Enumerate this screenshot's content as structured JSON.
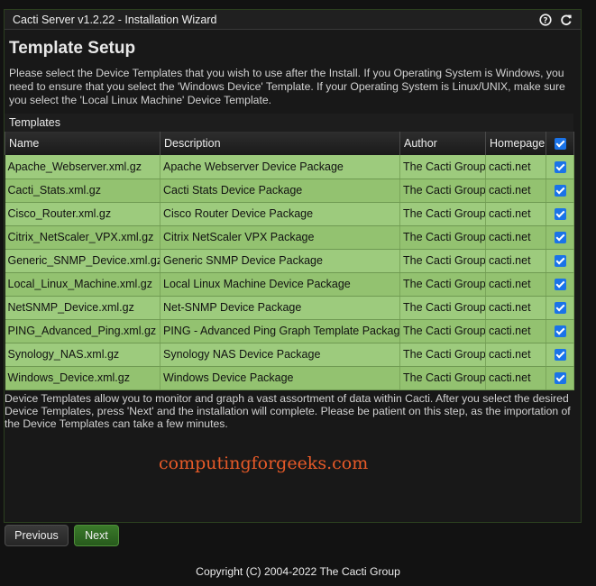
{
  "window": {
    "title": "Cacti Server v1.2.22 - Installation Wizard",
    "help_icon": "help-icon",
    "refresh_icon": "refresh-icon"
  },
  "page": {
    "heading": "Template Setup",
    "intro": "Please select the Device Templates that you wish to use after the Install. If you Operating System is Windows, you need to ensure that you select the 'Windows Device' Template. If your Operating System is Linux/UNIX, make sure you select the 'Local Linux Machine' Device Template.",
    "panel_title": "Templates",
    "after_text": "Device Templates allow you to monitor and graph a vast assortment of data within Cacti. After you select the desired Device Templates, press 'Next' and the installation will complete. Please be patient on this step, as the importation of the Device Templates can take a few minutes.",
    "watermark": "computingforgeeks.com"
  },
  "table": {
    "headers": {
      "name": "Name",
      "description": "Description",
      "author": "Author",
      "homepage": "Homepage"
    },
    "select_all_checked": true,
    "rows": [
      {
        "name": "Apache_Webserver.xml.gz",
        "description": "Apache Webserver Device Package",
        "author": "The Cacti Group",
        "homepage": "cacti.net",
        "checked": true
      },
      {
        "name": "Cacti_Stats.xml.gz",
        "description": "Cacti Stats Device Package",
        "author": "The Cacti Group",
        "homepage": "cacti.net",
        "checked": true
      },
      {
        "name": "Cisco_Router.xml.gz",
        "description": "Cisco Router Device Package",
        "author": "The Cacti Group",
        "homepage": "cacti.net",
        "checked": true
      },
      {
        "name": "Citrix_NetScaler_VPX.xml.gz",
        "description": "Citrix NetScaler VPX Package",
        "author": "The Cacti Group",
        "homepage": "cacti.net",
        "checked": true
      },
      {
        "name": "Generic_SNMP_Device.xml.gz",
        "description": "Generic SNMP Device Package",
        "author": "The Cacti Group",
        "homepage": "cacti.net",
        "checked": true
      },
      {
        "name": "Local_Linux_Machine.xml.gz",
        "description": "Local Linux Machine Device Package",
        "author": "The Cacti Group",
        "homepage": "cacti.net",
        "checked": true
      },
      {
        "name": "NetSNMP_Device.xml.gz",
        "description": "Net-SNMP Device Package",
        "author": "The Cacti Group",
        "homepage": "cacti.net",
        "checked": true
      },
      {
        "name": "PING_Advanced_Ping.xml.gz",
        "description": "PING - Advanced Ping Graph Template Package",
        "author": "The Cacti Group",
        "homepage": "cacti.net",
        "checked": true
      },
      {
        "name": "Synology_NAS.xml.gz",
        "description": "Synology NAS Device Package",
        "author": "The Cacti Group",
        "homepage": "cacti.net",
        "checked": true
      },
      {
        "name": "Windows_Device.xml.gz",
        "description": "Windows Device Package",
        "author": "The Cacti Group",
        "homepage": "cacti.net",
        "checked": true
      }
    ]
  },
  "buttons": {
    "previous": "Previous",
    "next": "Next"
  },
  "footer": {
    "copyright": "Copyright (C) 2004-2022 The Cacti Group"
  },
  "colors": {
    "row_green": "#9dcb7d",
    "row_green_alt": "#93c270",
    "checkbox_blue": "#1a73e8",
    "watermark": "#e85a28",
    "next_button": "#3a7a2a"
  }
}
